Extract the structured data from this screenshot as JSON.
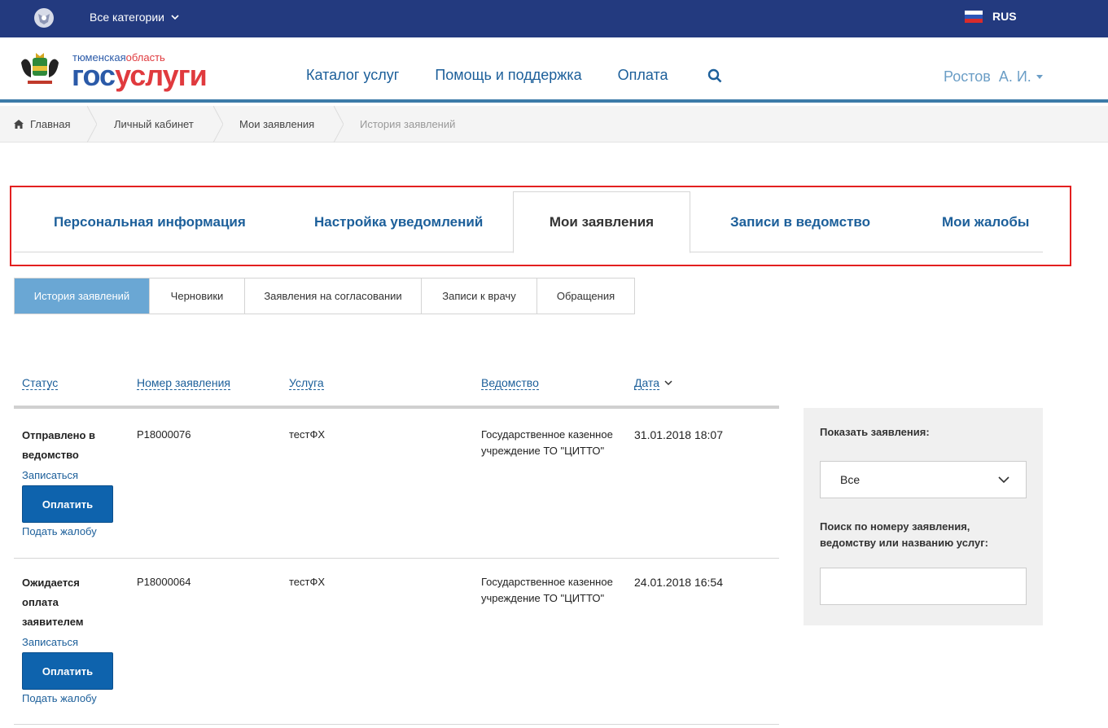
{
  "topbar": {
    "categories_label": "Все категории",
    "lang_label": "RUS",
    "icons": [
      "emblem-icon",
      "chevron-down-icon",
      "russia-flag-icon"
    ]
  },
  "header": {
    "region_prefix": "тюменская",
    "region_suffix": "область",
    "brand_gos": "гос",
    "brand_uslugi": "услуги",
    "nav": [
      "Каталог услуг",
      "Помощь и поддержка",
      "Оплата"
    ],
    "user_name": "Ростов  А. И.",
    "icons": [
      "coat-of-arms-icon",
      "search-icon",
      "caret-down-icon"
    ]
  },
  "breadcrumb": [
    "Главная",
    "Личный кабинет",
    "Мои заявления",
    "История заявлений"
  ],
  "main_tabs": [
    "Персональная информация",
    "Настройка уведомлений",
    "Мои заявления",
    "Записи в ведомство",
    "Мои жалобы"
  ],
  "sub_tabs": [
    "История заявлений",
    "Черновики",
    "Заявления на согласовании",
    "Записи к врачу",
    "Обращения"
  ],
  "table": {
    "headers": [
      "Статус",
      "Номер заявления",
      "Услуга",
      "Ведомство",
      "Дата"
    ],
    "rows": [
      {
        "status": "Отправлено в ведомство",
        "book_link": "Записаться",
        "pay_label": "Оплатить",
        "complaint_link": "Подать жалобу",
        "number": "P18000076",
        "service": "тестФХ",
        "department": "Государственное казенное учреждение ТО \"ЦИТТО\"",
        "date": "31.01.2018 18:07"
      },
      {
        "status": "Ожидается оплата заявителем",
        "book_link": "Записаться",
        "pay_label": "Оплатить",
        "complaint_link": "Подать жалобу",
        "number": "P18000064",
        "service": "тестФХ",
        "department": "Государственное казенное учреждение ТО \"ЦИТТО\"",
        "date": "24.01.2018 16:54"
      }
    ]
  },
  "side_panel": {
    "show_label": "Показать заявления:",
    "show_value": "Все",
    "search_label": "Поиск по номеру заявления, ведомству или названию услуг:",
    "search_value": ""
  },
  "colors": {
    "topbar": "#233a7f",
    "link": "#1c5f9a",
    "brand_red": "#e03a3e",
    "active_subtab": "#6aa7d4",
    "pay_button": "#0e63ad",
    "highlight_frame": "#e32020"
  }
}
